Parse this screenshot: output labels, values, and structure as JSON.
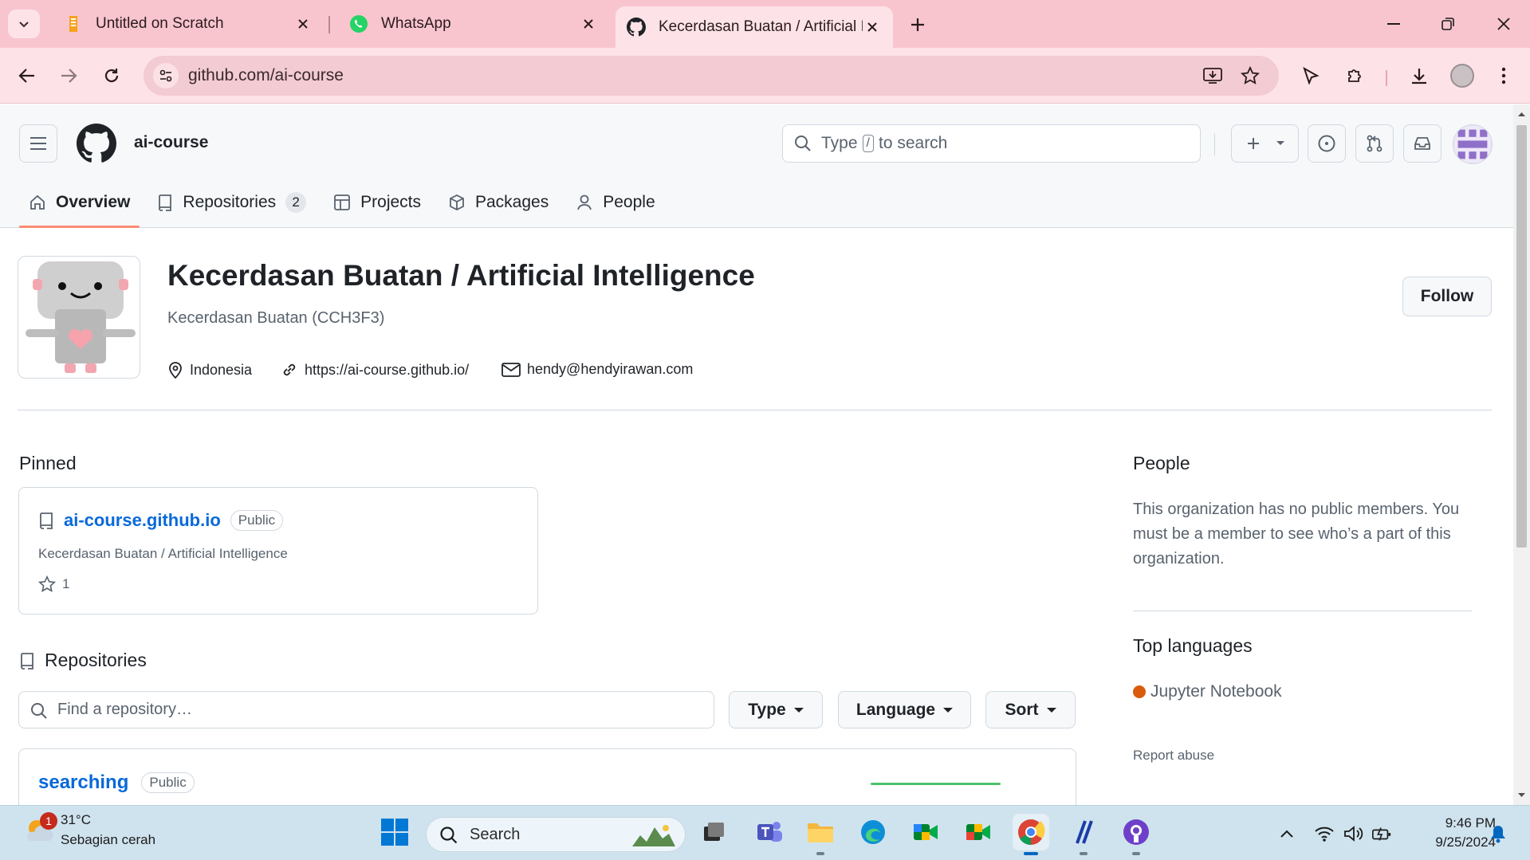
{
  "browser": {
    "tabs": [
      {
        "title": "Untitled on Scratch",
        "icon": "scratch-favicon"
      },
      {
        "title": "WhatsApp",
        "icon": "whatsapp-favicon"
      },
      {
        "title": "Kecerdasan Buatan / Artificial In",
        "icon": "github-favicon",
        "active": true
      }
    ],
    "url": "github.com/ai-course"
  },
  "github": {
    "org_slug": "ai-course",
    "search_prefix": "Type",
    "search_key": "/",
    "search_suffix": "to search",
    "nav": {
      "overview": "Overview",
      "repositories": "Repositories",
      "repositories_count": "2",
      "projects": "Projects",
      "packages": "Packages",
      "people": "People"
    },
    "org": {
      "title": "Kecerdasan Buatan / Artificial Intelligence",
      "description": "Kecerdasan Buatan (CCH3F3)",
      "location": "Indonesia",
      "website": "https://ai-course.github.io/",
      "email": "hendy@hendyirawan.com",
      "follow_label": "Follow"
    },
    "pinned": {
      "heading": "Pinned",
      "repo_name": "ai-course.github.io",
      "visibility": "Public",
      "description": "Kecerdasan Buatan / Artificial Intelligence",
      "stars": "1"
    },
    "repositories": {
      "heading": "Repositories",
      "search_placeholder": "Find a repository…",
      "type_label": "Type",
      "language_label": "Language",
      "sort_label": "Sort",
      "first_repo_name": "searching",
      "first_repo_visibility": "Public"
    },
    "sidebar": {
      "people_heading": "People",
      "people_text": "This organization has no public members. You must be a member to see who’s a part of this organization.",
      "top_languages_heading": "Top languages",
      "language": "Jupyter Notebook",
      "language_color": "#DA5B0B",
      "report_abuse": "Report abuse"
    }
  },
  "taskbar": {
    "weather_temp": "31°C",
    "weather_desc": "Sebagian cerah",
    "weather_badge": "1",
    "search_label": "Search",
    "time": "9:46 PM",
    "date": "9/25/2024"
  },
  "colors": {
    "accent": "#0969da",
    "tab_strip": "#f8c5cf",
    "toolbar": "#fde3e8",
    "nav_underline": "#fd8c73"
  }
}
